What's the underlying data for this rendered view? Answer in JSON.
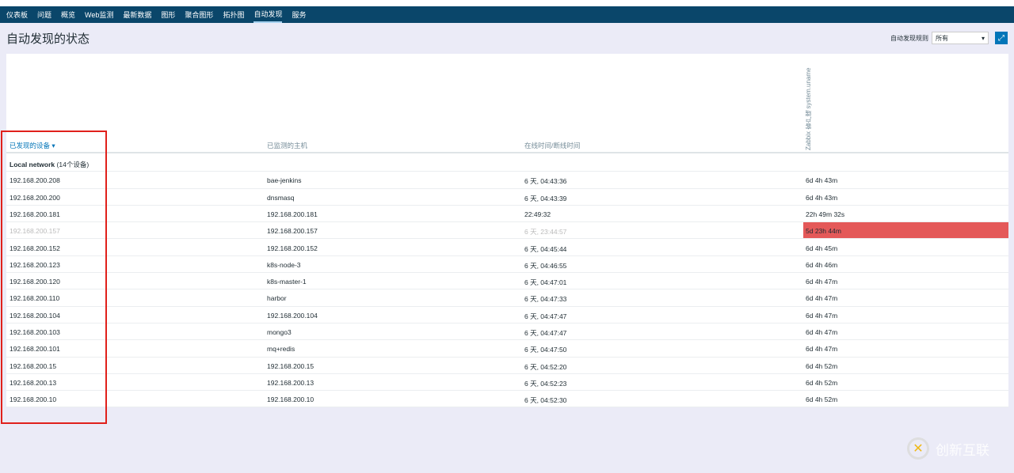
{
  "nav": [
    "仪表板",
    "问题",
    "概览",
    "Web监测",
    "最新数据",
    "图形",
    "聚合图形",
    "拓扑图",
    "自动发现",
    "服务"
  ],
  "active_nav": "自动发现",
  "page_title": "自动发现的状态",
  "filter": {
    "label": "自动发现规则",
    "value": "所有"
  },
  "columns": [
    "已发现的设备 ▾",
    "已监测的主机",
    "在线时间/断线时间",
    "Zabbix 客户端 system.uname"
  ],
  "group": {
    "name": "Local network",
    "count": "(14个设备)"
  },
  "rows": [
    {
      "ip": "192.168.200.208",
      "host": "bae-jenkins",
      "uptime": "6 天, 04:43:36",
      "agent": "6d 4h 43m"
    },
    {
      "ip": "192.168.200.200",
      "host": "dnsmasq",
      "uptime": "6 天, 04:43:39",
      "agent": "6d 4h 43m"
    },
    {
      "ip": "192.168.200.181",
      "host": "192.168.200.181",
      "uptime": "22:49:32",
      "agent": "22h 49m 32s"
    },
    {
      "ip": "192.168.200.157",
      "host": "192.168.200.157",
      "uptime": "6 天, 23:44:57",
      "agent": "5d 23h 44m",
      "down": true
    },
    {
      "ip": "192.168.200.152",
      "host": "192.168.200.152",
      "uptime": "6 天, 04:45:44",
      "agent": "6d 4h 45m"
    },
    {
      "ip": "192.168.200.123",
      "host": "k8s-node-3",
      "uptime": "6 天, 04:46:55",
      "agent": "6d 4h 46m"
    },
    {
      "ip": "192.168.200.120",
      "host": "k8s-master-1",
      "uptime": "6 天, 04:47:01",
      "agent": "6d 4h 47m"
    },
    {
      "ip": "192.168.200.110",
      "host": "harbor",
      "uptime": "6 天, 04:47:33",
      "agent": "6d 4h 47m"
    },
    {
      "ip": "192.168.200.104",
      "host": "192.168.200.104",
      "uptime": "6 天, 04:47:47",
      "agent": "6d 4h 47m"
    },
    {
      "ip": "192.168.200.103",
      "host": "mongo3",
      "uptime": "6 天, 04:47:47",
      "agent": "6d 4h 47m"
    },
    {
      "ip": "192.168.200.101",
      "host": "mq+redis",
      "uptime": "6 天, 04:47:50",
      "agent": "6d 4h 47m"
    },
    {
      "ip": "192.168.200.15",
      "host": "192.168.200.15",
      "uptime": "6 天, 04:52:20",
      "agent": "6d 4h 52m"
    },
    {
      "ip": "192.168.200.13",
      "host": "192.168.200.13",
      "uptime": "6 天, 04:52:23",
      "agent": "6d 4h 52m"
    },
    {
      "ip": "192.168.200.10",
      "host": "192.168.200.10",
      "uptime": "6 天, 04:52:30",
      "agent": "6d 4h 52m"
    }
  ],
  "watermark": "创新互联",
  "colors": {
    "nav": "#0a466a",
    "down": "#e45959",
    "accent": "#0275b8"
  }
}
